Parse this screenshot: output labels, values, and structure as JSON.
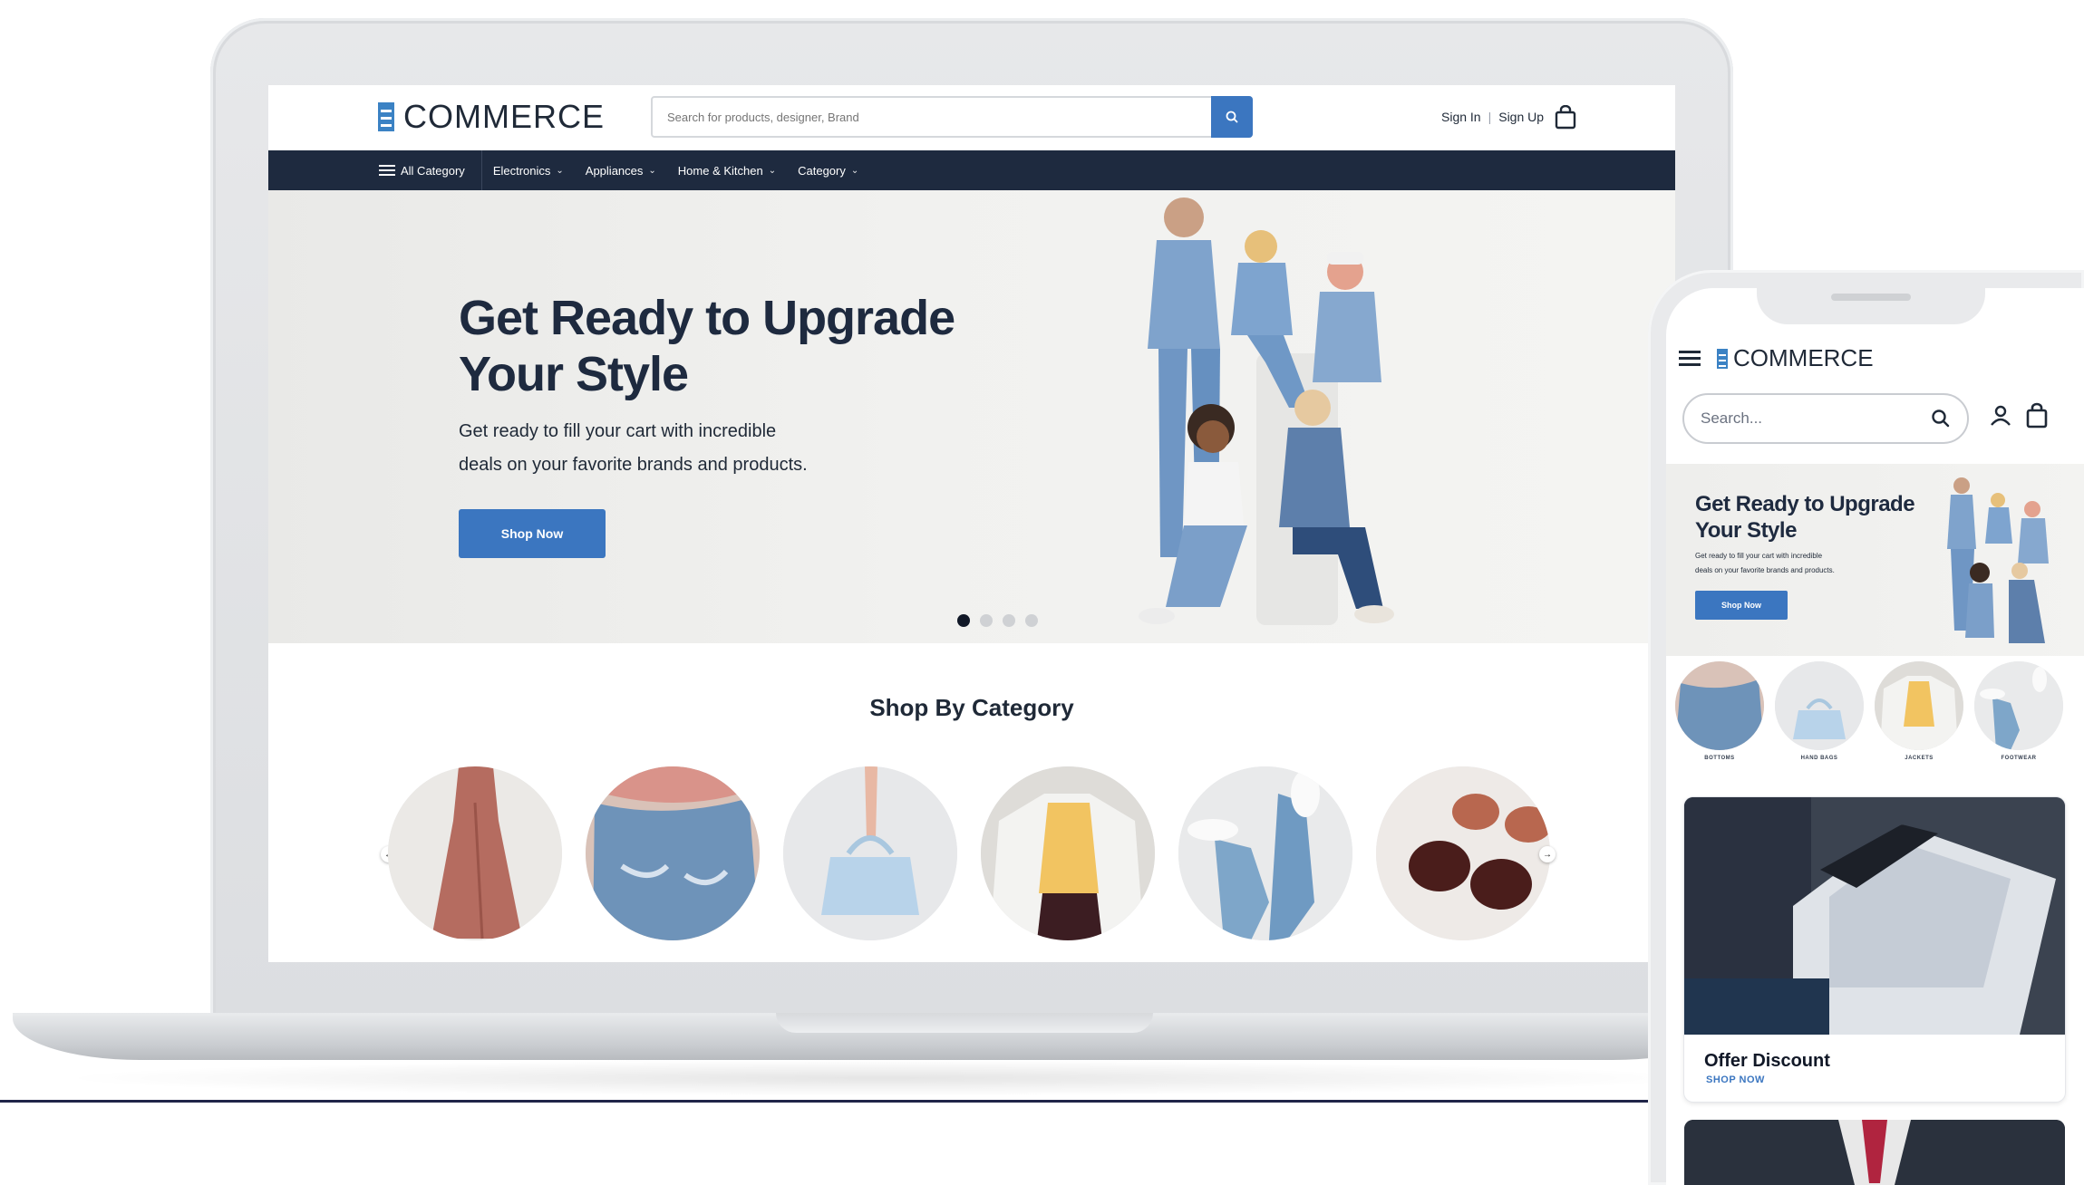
{
  "brand": {
    "name": "COMMERCE",
    "accent": "#3b76c0",
    "nav_bg": "#1e2a3f"
  },
  "desktop": {
    "search": {
      "placeholder": "Search for products, designer, Brand",
      "icon": "search-icon"
    },
    "auth": {
      "sign_in": "Sign In",
      "separator": "|",
      "sign_up": "Sign Up"
    },
    "cart_icon": "shopping-bag-icon",
    "nav": [
      {
        "label": "All Category",
        "icon": "menu-icon"
      },
      {
        "label": "Electronics",
        "icon": "chevron-down-icon"
      },
      {
        "label": "Appliances",
        "icon": "chevron-down-icon"
      },
      {
        "label": "Home & Kitchen",
        "icon": "chevron-down-icon"
      },
      {
        "label": "Category",
        "icon": "chevron-down-icon"
      }
    ],
    "hero": {
      "title_line1": "Get Ready to Upgrade",
      "title_line2": "Your Style",
      "subtitle_line1": "Get ready to fill your cart with incredible",
      "subtitle_line2": "deals on your favorite brands and products.",
      "cta": "Shop Now",
      "slides": 4,
      "active_slide": 1
    },
    "categories": {
      "title": "Shop By Category",
      "items": [
        "dress",
        "jeans",
        "handbag",
        "jacket",
        "sneakers",
        "sunglasses"
      ]
    }
  },
  "mobile": {
    "search_placeholder": "Search...",
    "hero": {
      "title_line1": "Get Ready to Upgrade",
      "title_line2": "Your Style",
      "subtitle_line1": "Get ready to fill your cart with incredible",
      "subtitle_line2": "deals on your favorite brands and products.",
      "cta": "Shop Now"
    },
    "categories": [
      "BOTTOMS",
      "HAND BAGS",
      "JACKETS",
      "FOOTWEAR"
    ],
    "offer": {
      "title": "Offer Discount",
      "link": "SHOP NOW"
    }
  }
}
